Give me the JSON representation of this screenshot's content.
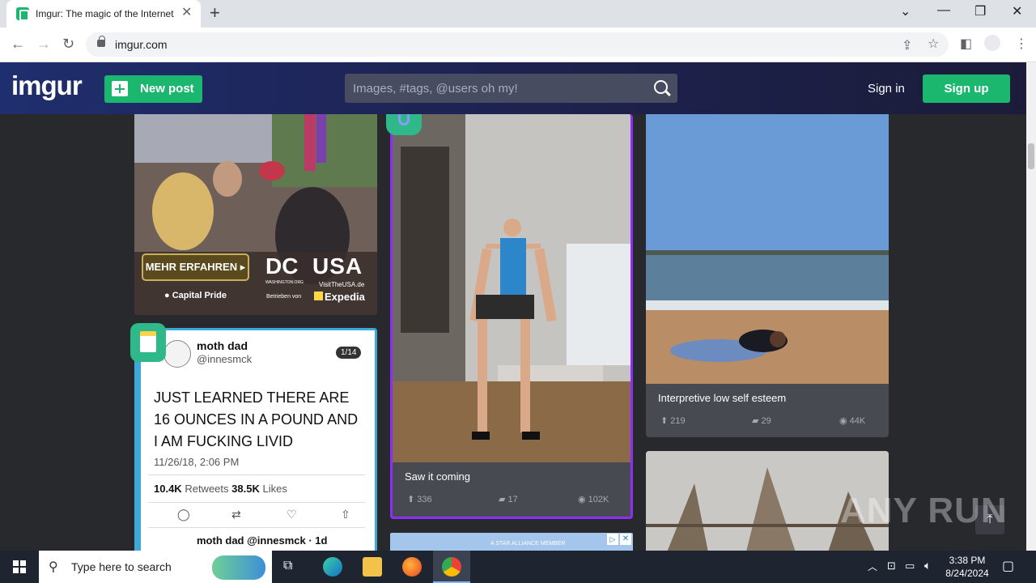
{
  "browser": {
    "tab_title": "Imgur: The magic of the Internet",
    "url": "imgur.com"
  },
  "header": {
    "logo": "imgur",
    "new_post": "New post",
    "search_placeholder": "Images, #tags, @users oh my!",
    "sign_in": "Sign in",
    "sign_up": "Sign up"
  },
  "posts": {
    "ad": {
      "cta": "MEHR ERFAHREN",
      "location": "Capital Pride",
      "brand1": "DC",
      "brand1_sub": "WASHINGTON.ORG",
      "brand2": "USA",
      "brand2_sub": "VisitTheUSA.de",
      "powered": "Betrieben von",
      "expedia": "Expedia"
    },
    "tweet": {
      "name": "moth dad",
      "handle": "@innesmck",
      "counter": "1/14",
      "text": "JUST LEARNED THERE ARE 16 OUNCES IN A POUND AND I AM FUCKING LIVID",
      "date": "11/26/18, 2:06 PM",
      "retweets_count": "10.4K",
      "retweets_label": "Retweets",
      "likes_count": "38.5K",
      "likes_label": "Likes",
      "reply_line": "moth dad @innesmck · 1d"
    },
    "video": {
      "caption": "Saw it coming",
      "upvotes": "336",
      "comments": "17",
      "views": "102K"
    },
    "beach": {
      "caption": "Interpretive low self esteem",
      "upvotes": "219",
      "comments": "29",
      "views": "44K"
    },
    "banner": {
      "text": "A STAR ALLIANCE MEMBER"
    }
  },
  "taskbar": {
    "search_placeholder": "Type here to search",
    "time": "3:38 PM",
    "date": "8/24/2024"
  },
  "watermark": "ANY RUN",
  "colors": {
    "imgur_green": "#1bb76e",
    "header_blue": "#1d2352",
    "page_bg": "#27292d",
    "card_bg": "#474a51",
    "video_border": "#8c2ef8",
    "tweet_border": "#3fa8d8"
  }
}
